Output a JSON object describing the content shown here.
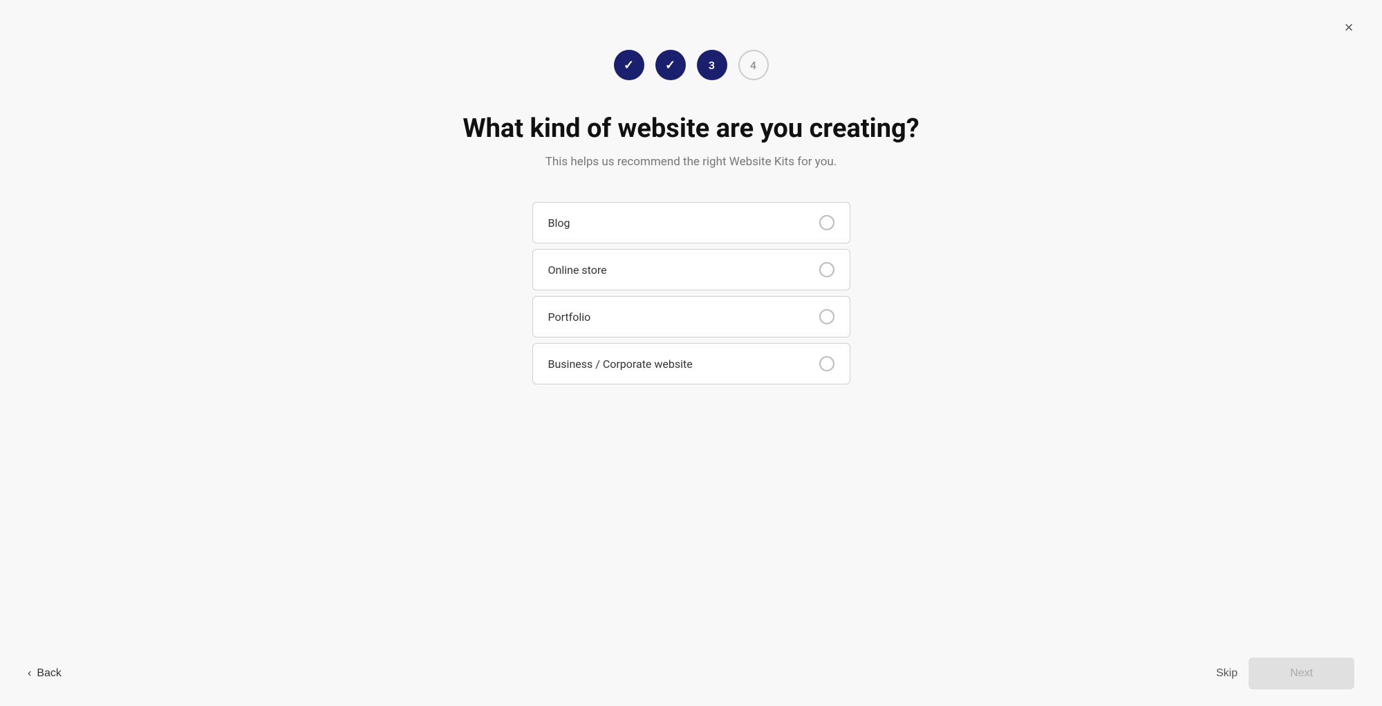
{
  "close": {
    "label": "×"
  },
  "steps": [
    {
      "id": 1,
      "state": "complete",
      "label": "✓"
    },
    {
      "id": 2,
      "state": "complete",
      "label": "✓"
    },
    {
      "id": 3,
      "state": "active",
      "label": "3"
    },
    {
      "id": 4,
      "state": "inactive",
      "label": "4"
    }
  ],
  "heading": {
    "title": "What kind of website are you creating?",
    "subtitle": "This helps us recommend the right Website Kits for you."
  },
  "options": [
    {
      "id": "blog",
      "label": "Blog"
    },
    {
      "id": "online-store",
      "label": "Online store"
    },
    {
      "id": "portfolio",
      "label": "Portfolio"
    },
    {
      "id": "business",
      "label": "Business / Corporate website"
    }
  ],
  "nav": {
    "back_label": "Back",
    "skip_label": "Skip",
    "next_label": "Next"
  }
}
